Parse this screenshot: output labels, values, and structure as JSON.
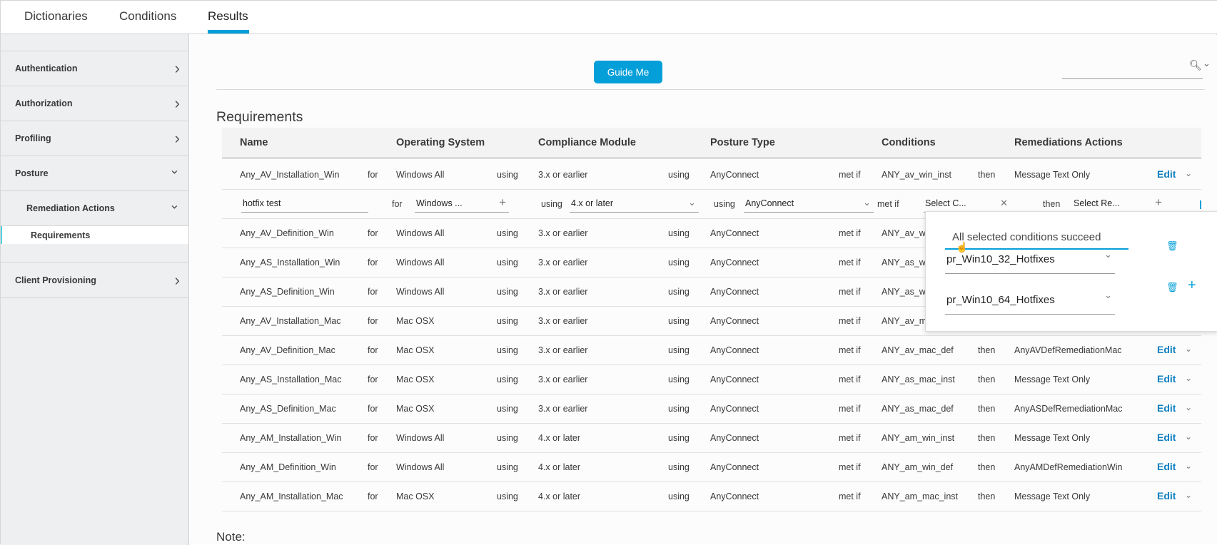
{
  "tabs": [
    {
      "label": "Dictionaries"
    },
    {
      "label": "Conditions"
    },
    {
      "label": "Results",
      "active": true
    }
  ],
  "sidebar": {
    "items": [
      {
        "label": "Authentication",
        "icon": "chevron-right-icon",
        "glyph": "›"
      },
      {
        "label": "Authorization",
        "icon": "chevron-right-icon",
        "glyph": "›"
      },
      {
        "label": "Profiling",
        "icon": "chevron-right-icon",
        "glyph": "›"
      },
      {
        "label": "Posture",
        "icon": "chevron-down-icon",
        "glyph": "⌄"
      },
      {
        "label": "Remediation Actions",
        "icon": "chevron-down-icon",
        "glyph": "⌄"
      },
      {
        "label": "Requirements",
        "active": true
      },
      {
        "label": "Client Provisioning",
        "icon": "chevron-right-icon",
        "glyph": "›"
      }
    ]
  },
  "toolbar": {
    "guide_me": "Guide Me",
    "search_icon": "🔍︎",
    "search_chevron": "⌄"
  },
  "page": {
    "title": "Requirements",
    "note": "Note:"
  },
  "table": {
    "headers": [
      "Name",
      "Operating System",
      "Compliance Module",
      "Posture Type",
      "Conditions",
      "Remediations Actions"
    ],
    "words": {
      "for": "for",
      "using": "using",
      "met_if": "met if",
      "then": "then",
      "edit": "Edit",
      "edit_chevron": "⌄"
    },
    "rows": [
      {
        "name": "Any_AV_Installation_Win",
        "os": "Windows All",
        "module": "3.x or earlier",
        "posture": "AnyConnect",
        "conditions": "ANY_av_win_inst",
        "remediation": "Message Text Only"
      },
      {
        "editing": true
      },
      {
        "name": "Any_AV_Definition_Win",
        "os": "Windows All",
        "module": "3.x or earlier",
        "posture": "AnyConnect",
        "conditions": "ANY_av_w",
        "remediation": ""
      },
      {
        "name": "Any_AS_Installation_Win",
        "os": "Windows All",
        "module": "3.x or earlier",
        "posture": "AnyConnect",
        "conditions": "ANY_as_w",
        "remediation": ""
      },
      {
        "name": "Any_AS_Definition_Win",
        "os": "Windows All",
        "module": "3.x or earlier",
        "posture": "AnyConnect",
        "conditions": "ANY_as_w",
        "remediation": ""
      },
      {
        "name": "Any_AV_Installation_Mac",
        "os": "Mac OSX",
        "module": "3.x or earlier",
        "posture": "AnyConnect",
        "conditions": "ANY_av_m",
        "remediation": ""
      },
      {
        "name": "Any_AV_Definition_Mac",
        "os": "Mac OSX",
        "module": "3.x or earlier",
        "posture": "AnyConnect",
        "conditions": "ANY_av_mac_def",
        "remediation": "AnyAVDefRemediationMac"
      },
      {
        "name": "Any_AS_Installation_Mac",
        "os": "Mac OSX",
        "module": "3.x or earlier",
        "posture": "AnyConnect",
        "conditions": "ANY_as_mac_inst",
        "remediation": "Message Text Only"
      },
      {
        "name": "Any_AS_Definition_Mac",
        "os": "Mac OSX",
        "module": "3.x or earlier",
        "posture": "AnyConnect",
        "conditions": "ANY_as_mac_def",
        "remediation": "AnyASDefRemediationMac"
      },
      {
        "name": "Any_AM_Installation_Win",
        "os": "Windows All",
        "module": "4.x or later",
        "posture": "AnyConnect",
        "conditions": "ANY_am_win_inst",
        "remediation": "Message Text Only"
      },
      {
        "name": "Any_AM_Definition_Win",
        "os": "Windows All",
        "module": "4.x or later",
        "posture": "AnyConnect",
        "conditions": "ANY_am_win_def",
        "remediation": "AnyAMDefRemediationWin"
      },
      {
        "name": "Any_AM_Installation_Mac",
        "os": "Mac OSX",
        "module": "4.x or later",
        "posture": "AnyConnect",
        "conditions": "ANY_am_mac_inst",
        "remediation": "Message Text Only"
      }
    ]
  },
  "edit_row": {
    "name": "hotfix test",
    "os": "Windows ...",
    "module": "4.x or later",
    "posture": "AnyConnect",
    "conditions": "Select C...",
    "remediation": "Select Re...",
    "plus": "+",
    "clear": "✕",
    "chevron": "⌄"
  },
  "popover": {
    "operator": "All selected conditions succeed",
    "conditions": [
      {
        "value": "pr_Win10_32_Hotfixes"
      },
      {
        "value": "pr_Win10_64_Hotfixes"
      }
    ],
    "delete_icon": "🗑︎",
    "add_icon": "+"
  },
  "colors": {
    "accent": "#049fd9",
    "link": "#0d7fc1",
    "sidebar_bg": "#eeeff1"
  }
}
